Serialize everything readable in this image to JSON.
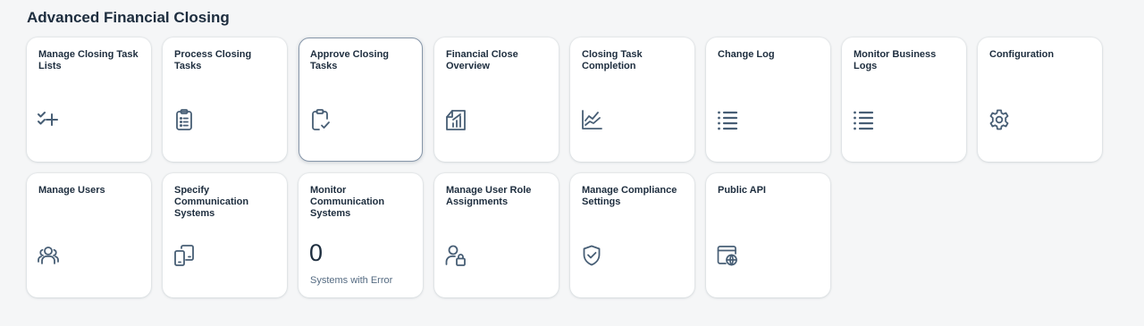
{
  "group": {
    "title": "Advanced Financial Closing"
  },
  "tiles": [
    {
      "title": "Manage Closing Task Lists",
      "icon": "check-list-add-icon"
    },
    {
      "title": "Process Closing Tasks",
      "icon": "clipboard-task-list-icon"
    },
    {
      "title": "Approve Closing Tasks",
      "icon": "clipboard-check-icon"
    },
    {
      "title": "Financial Close Overview",
      "icon": "financial-report-chart-icon"
    },
    {
      "title": "Closing Task Completion",
      "icon": "line-chart-icon"
    },
    {
      "title": "Change Log",
      "icon": "bulleted-list-icon"
    },
    {
      "title": "Monitor Business Logs",
      "icon": "bulleted-list-icon"
    },
    {
      "title": "Configuration",
      "icon": "gear-icon"
    },
    {
      "title": "Manage Users",
      "icon": "user-group-icon"
    },
    {
      "title": "Specify Communication Systems",
      "icon": "connected-devices-icon"
    },
    {
      "title": "Monitor Communication Systems",
      "kpi_value": "0",
      "kpi_footer": "Systems with Error"
    },
    {
      "title": "Manage User Role Assignments",
      "icon": "user-lock-icon"
    },
    {
      "title": "Manage Compliance Settings",
      "icon": "shield-check-icon"
    },
    {
      "title": "Public API",
      "icon": "browser-globe-icon"
    }
  ],
  "colors": {
    "background": "#f5f6f7",
    "tile": "#ffffff",
    "title_text": "#1d2d3e",
    "icon": "#475e75",
    "footer_text": "#556b82"
  }
}
